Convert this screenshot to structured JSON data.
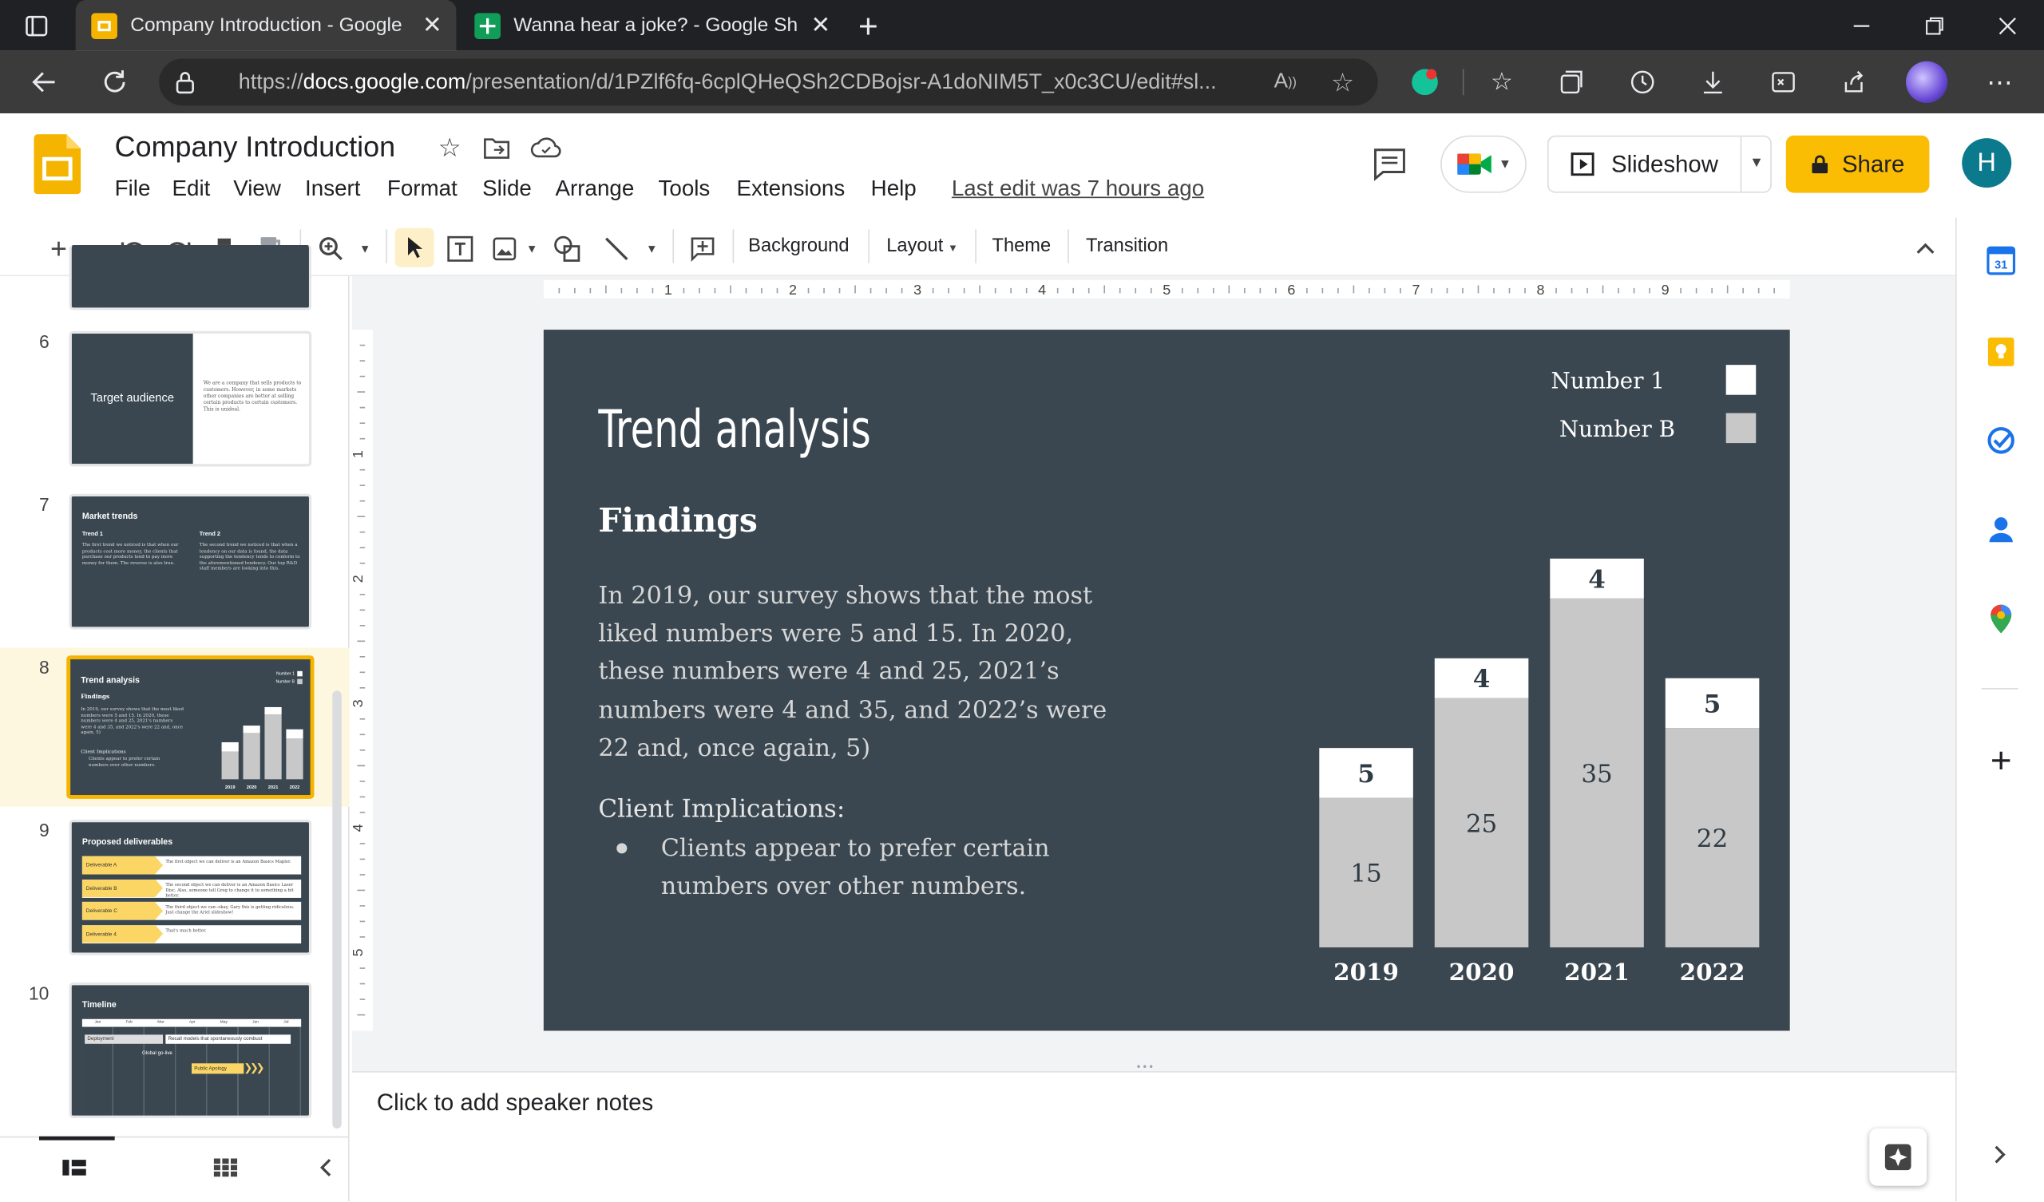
{
  "browser": {
    "tabs": [
      {
        "title": "Company Introduction - Google",
        "color": "#f4b400"
      },
      {
        "title": "Wanna hear a joke? - Google She",
        "color": "#0f9d58"
      }
    ],
    "url_prefix": "https://",
    "url_domain": "docs.google.com",
    "url_path": "/presentation/d/1PZlf6fq-6cplQHeQSh2CDBojsr-A1doNIM5T_x0c3CU/edit#sl..."
  },
  "doc": {
    "title": "Company Introduction",
    "menus": [
      "File",
      "Edit",
      "View",
      "Insert",
      "Format",
      "Slide",
      "Arrange",
      "Tools",
      "Extensions",
      "Help"
    ],
    "last_edit": "Last edit was 7 hours ago",
    "slideshow_label": "Slideshow",
    "share_label": "Share",
    "avatar_letter": "H",
    "accent": "#fbbc04"
  },
  "toolbar": {
    "background": "Background",
    "layout": "Layout",
    "theme": "Theme",
    "transition": "Transition"
  },
  "ruler": [
    "1",
    "2",
    "3",
    "4",
    "5",
    "6",
    "7",
    "8",
    "9"
  ],
  "vruler": [
    "1",
    "2",
    "3",
    "4",
    "5"
  ],
  "filmstrip": {
    "items": [
      {
        "num": "6",
        "title": "Target audience",
        "body": "We are a company that sells products to customers. However, in some markets other companies are better at selling certain products to certain customers. This is unideal."
      },
      {
        "num": "7",
        "title": "Market trends",
        "trend1": "Trend 1",
        "trend2": "Trend 2",
        "body1": "The first trend we noticed is that when our products cost more money, the clients that purchase our products tend to pay more money for them. The reverse is also true.",
        "body2": "The second trend we noticed is that when a tendency on our data is found, the data supporting the tendency tends to conform to the aforementioned tendency. Our top R&D staff members are looking into this."
      },
      {
        "num": "8",
        "title": "Trend analysis",
        "findings": "Findings",
        "body": "In 2019, our survey shows that the most liked numbers were 5 and 15. In 2020, these numbers were 4 and 25, 2021's numbers were 4 and 35, and 2022's were 22 and, once again, 5)",
        "impl": "Client Implications",
        "bullet": "Clients appear to prefer certain numbers over other numbers."
      },
      {
        "num": "9",
        "title": "Proposed deliverables",
        "rows": [
          {
            "label": "Deliverable A",
            "text": "The first object we can deliver is an Amazon Basics Mapler."
          },
          {
            "label": "Deliverable B",
            "text": "The second object we can deliver is an Amazon Basics Laser Disc. Also, someone tell Greg to change it to something a bit better."
          },
          {
            "label": "Deliverable C",
            "text": "The third object we can--okay, Gary this is getting ridiculous. Just change the Ariel slideshow!"
          },
          {
            "label": "Deliverable 4",
            "text": "That's much better."
          }
        ]
      },
      {
        "num": "10",
        "title": "Timeline",
        "months": [
          "Jan",
          "Feb",
          "Mar",
          "Apr",
          "May",
          "Jun",
          "Jul"
        ],
        "items": [
          "Deployment",
          "Recall models that spontaneously combust",
          "Global go-live",
          "Public Apology"
        ]
      }
    ]
  },
  "slide": {
    "title": "Trend analysis",
    "findings_heading": "Findings",
    "findings_body": "In 2019, our survey shows that the most liked numbers were 5 and 15. In 2020, these numbers were 4 and 25, 2021’s numbers were 4 and 35, and 2022’s were 22 and, once again, 5)",
    "implications_heading": "Client Implications:",
    "implication_bullet": "Clients appear to prefer certain numbers over other numbers.",
    "background_color": "#3a4750"
  },
  "chart_data": {
    "type": "bar",
    "stacked": true,
    "categories": [
      "2019",
      "2020",
      "2021",
      "2022"
    ],
    "series": [
      {
        "name": "Number B",
        "values": [
          15,
          25,
          35,
          22
        ],
        "color": "#c8c8c8"
      },
      {
        "name": "Number 1",
        "values": [
          5,
          4,
          4,
          5
        ],
        "color": "#ffffff"
      }
    ],
    "legend_position": "top-right",
    "data_labels": true
  },
  "notes": {
    "placeholder": "Click to add speaker notes"
  }
}
